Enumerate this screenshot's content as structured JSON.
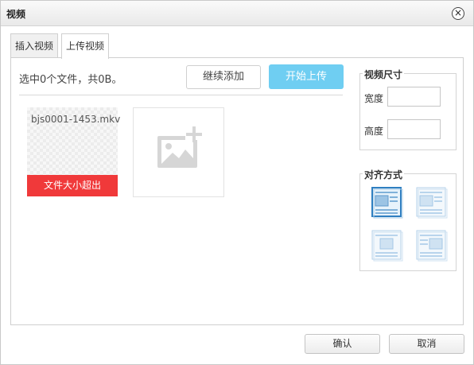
{
  "dialog": {
    "title": "视频",
    "close_label": "×"
  },
  "tabs": [
    {
      "label": "插入视频",
      "active": false
    },
    {
      "label": "上传视频",
      "active": true
    }
  ],
  "upload": {
    "status": "选中0个文件，共0B。",
    "continue_label": "继续添加",
    "start_label": "开始上传",
    "start_color": "#6fcef2",
    "file": {
      "name": "bjs0001-1453.mkv",
      "error": "文件大小超出",
      "error_color": "#f0393a"
    },
    "add_icon": "image-add-icon"
  },
  "size_panel": {
    "legend": "视频尺寸",
    "width_label": "宽度",
    "width_value": "",
    "height_label": "高度",
    "height_value": ""
  },
  "align_panel": {
    "legend": "对齐方式",
    "options": [
      {
        "icon": "align-none-icon",
        "selected": true
      },
      {
        "icon": "align-left-icon",
        "selected": false
      },
      {
        "icon": "align-center-icon",
        "selected": false
      },
      {
        "icon": "align-right-icon",
        "selected": false
      }
    ]
  },
  "footer": {
    "ok_label": "确认",
    "cancel_label": "取消"
  }
}
